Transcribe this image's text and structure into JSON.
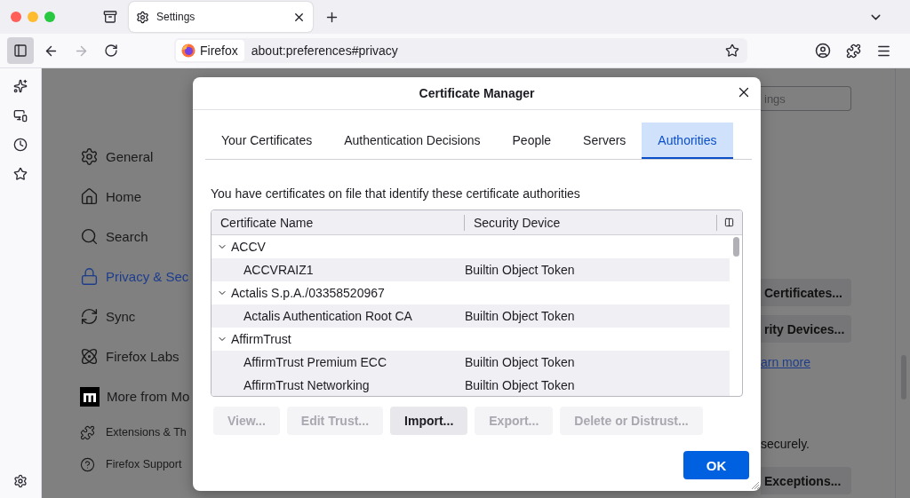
{
  "browser": {
    "tabs": [
      {
        "label": "Settings",
        "selected": true
      }
    ],
    "identity_label": "Firefox",
    "url": "about:preferences#privacy"
  },
  "settings_nav": [
    {
      "label": "General",
      "selected": false,
      "kind": "main"
    },
    {
      "label": "Home",
      "selected": false,
      "kind": "main"
    },
    {
      "label": "Search",
      "selected": false,
      "kind": "main"
    },
    {
      "label": "Privacy & Sec",
      "selected": true,
      "kind": "main"
    },
    {
      "label": "Sync",
      "selected": false,
      "kind": "main"
    },
    {
      "label": "Firefox Labs",
      "selected": false,
      "kind": "main"
    },
    {
      "label": "More from Mo",
      "selected": false,
      "kind": "main"
    },
    {
      "label": "Extensions & Th",
      "selected": false,
      "kind": "footer"
    },
    {
      "label": "Firefox Support",
      "selected": false,
      "kind": "footer"
    }
  ],
  "background": {
    "search_placeholder": "ings",
    "certificate_buttons": [
      "Certificates...",
      "rity Devices..."
    ],
    "link": "arn more",
    "text": "securely.",
    "exceptions_button": "Exceptions..."
  },
  "dialog": {
    "title": "Certificate Manager",
    "tabs": [
      {
        "label": "Your Certificates",
        "selected": false
      },
      {
        "label": "Authentication Decisions",
        "selected": false
      },
      {
        "label": "People",
        "selected": false
      },
      {
        "label": "Servers",
        "selected": false
      },
      {
        "label": "Authorities",
        "selected": true
      }
    ],
    "description": "You have certificates on file that identify these certificate authorities",
    "table": {
      "columns": [
        "Certificate Name",
        "Security Device"
      ],
      "groups": [
        {
          "name": "ACCV",
          "expanded": true,
          "children": [
            {
              "name": "ACCVRAIZ1",
              "device": "Builtin Object Token"
            }
          ]
        },
        {
          "name": "Actalis S.p.A./03358520967",
          "expanded": true,
          "children": [
            {
              "name": "Actalis Authentication Root CA",
              "device": "Builtin Object Token"
            }
          ]
        },
        {
          "name": "AffirmTrust",
          "expanded": true,
          "children": [
            {
              "name": "AffirmTrust Premium ECC",
              "device": "Builtin Object Token"
            },
            {
              "name": "AffirmTrust Networking",
              "device": "Builtin Object Token"
            }
          ]
        }
      ]
    },
    "buttons": [
      {
        "label": "View...",
        "disabled": true
      },
      {
        "label": "Edit Trust...",
        "disabled": true
      },
      {
        "label": "Import...",
        "disabled": false
      },
      {
        "label": "Export...",
        "disabled": true
      },
      {
        "label": "Delete or Distrust...",
        "disabled": true
      }
    ],
    "ok_button": "OK"
  }
}
